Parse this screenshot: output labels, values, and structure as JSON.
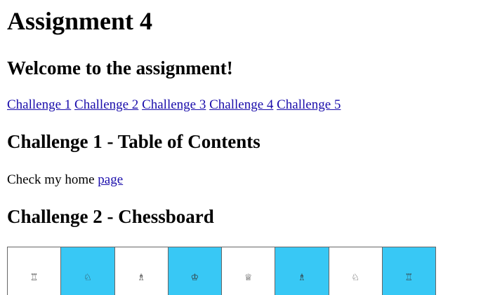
{
  "page": {
    "title": "Assignment 4",
    "welcome": "Welcome to the assignment!"
  },
  "nav": {
    "links": [
      {
        "label": "Challenge 1"
      },
      {
        "label": "Challenge 2"
      },
      {
        "label": "Challenge 3"
      },
      {
        "label": "Challenge 4"
      },
      {
        "label": "Challenge 5"
      }
    ]
  },
  "challenge1": {
    "heading": "Challenge 1 - Table of Contents",
    "text": "Check my home",
    "link_label": "page"
  },
  "challenge2": {
    "heading": "Challenge 2 - Chessboard",
    "colors": {
      "light": "#ffffff",
      "dark": "#38c8f5"
    },
    "squares": [
      {
        "shade": "light",
        "piece": "♖",
        "icon": "rook-icon"
      },
      {
        "shade": "dark",
        "piece": "♘",
        "icon": "knight-icon"
      },
      {
        "shade": "light",
        "piece": "♗",
        "icon": "bishop-icon"
      },
      {
        "shade": "dark",
        "piece": "♔",
        "icon": "king-icon"
      },
      {
        "shade": "light",
        "piece": "♕",
        "icon": "queen-icon"
      },
      {
        "shade": "dark",
        "piece": "♗",
        "icon": "bishop-icon"
      },
      {
        "shade": "light",
        "piece": "♘",
        "icon": "knight-icon"
      },
      {
        "shade": "dark",
        "piece": "♖",
        "icon": "rook-icon"
      }
    ]
  }
}
